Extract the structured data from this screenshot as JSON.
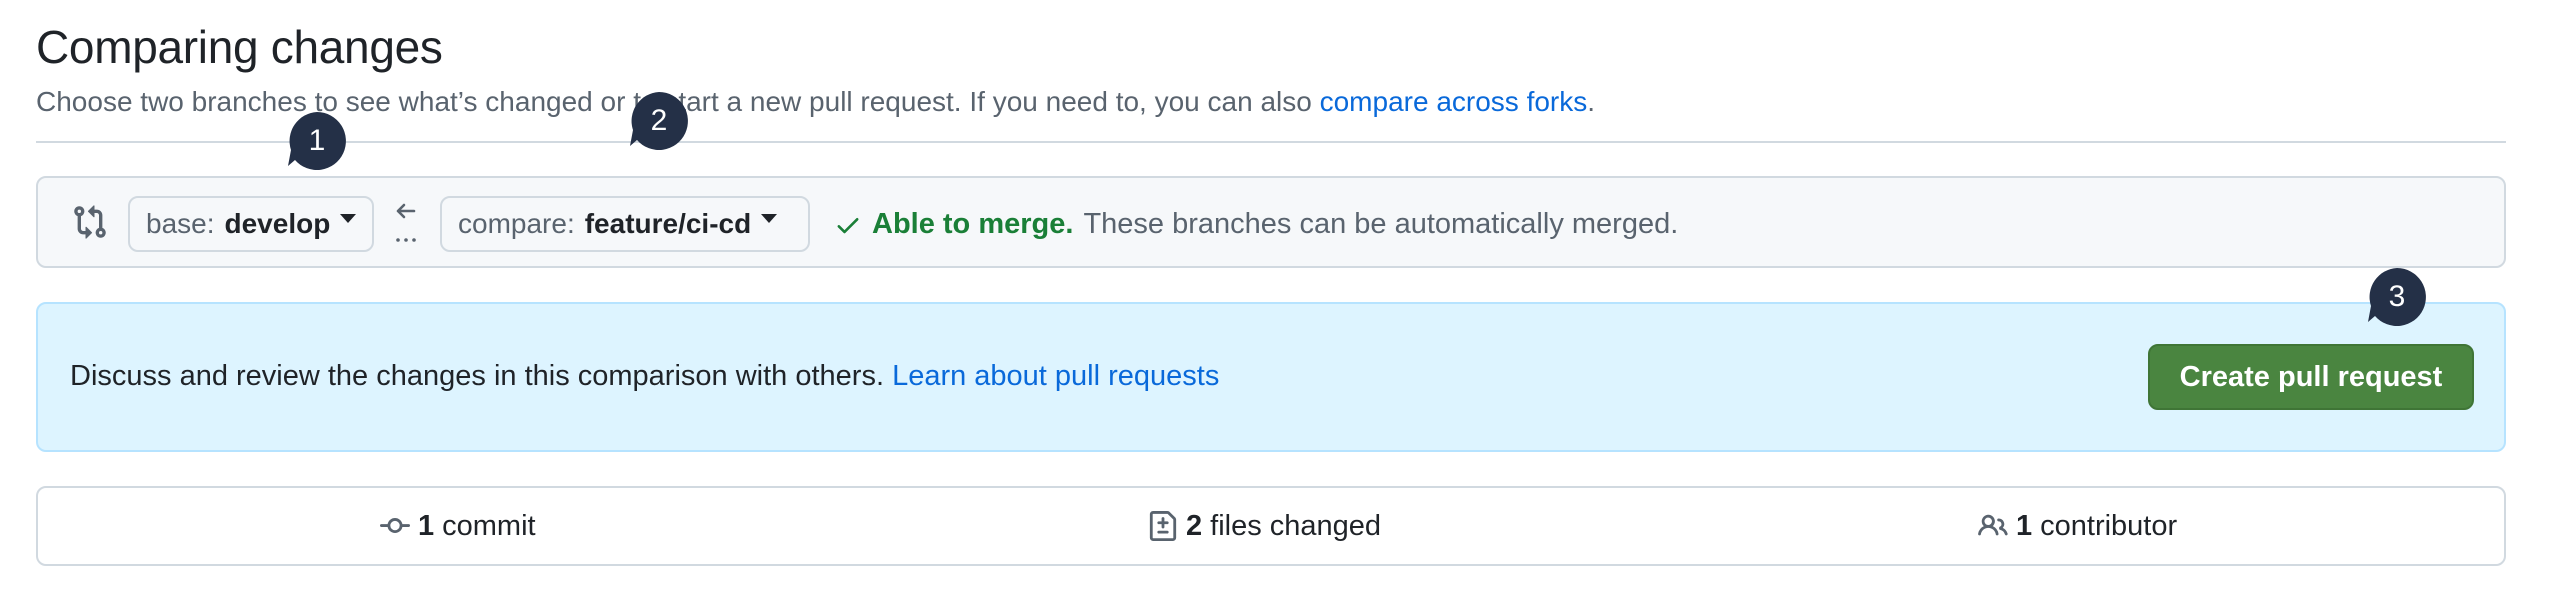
{
  "header": {
    "title": "Comparing changes",
    "subtitle_text": "Choose two branches to see what’s changed or to start a new pull request. If you need to, you can also ",
    "subtitle_link": "compare across forks",
    "subtitle_end": "."
  },
  "compare_bar": {
    "base_prefix": "base:",
    "base_value": "develop",
    "compare_prefix": "compare:",
    "compare_value": "feature/ci-cd",
    "merge_ok": "Able to merge.",
    "merge_desc": "These branches can be automatically merged."
  },
  "discuss": {
    "text": "Discuss and review the changes in this comparison with others. ",
    "link": "Learn about pull requests",
    "button": "Create pull request"
  },
  "stats": {
    "commits_count": "1",
    "commits_label": "commit",
    "files_count": "2",
    "files_label": "files changed",
    "contributors_count": "1",
    "contributors_label": "contributor"
  },
  "annotations": [
    "1",
    "2",
    "3"
  ],
  "colors": {
    "link": "#0969da",
    "success": "#1a7f37",
    "create_button": "#4a8540",
    "info_bg": "#ddf4ff",
    "bubble": "#243047"
  },
  "icons": {
    "compare_bar": "git-compare-icon",
    "arrow": "arrow-left-icon",
    "merge_ok": "check-icon",
    "commits": "git-commit-icon",
    "files": "file-diff-icon",
    "contributors": "people-icon"
  }
}
